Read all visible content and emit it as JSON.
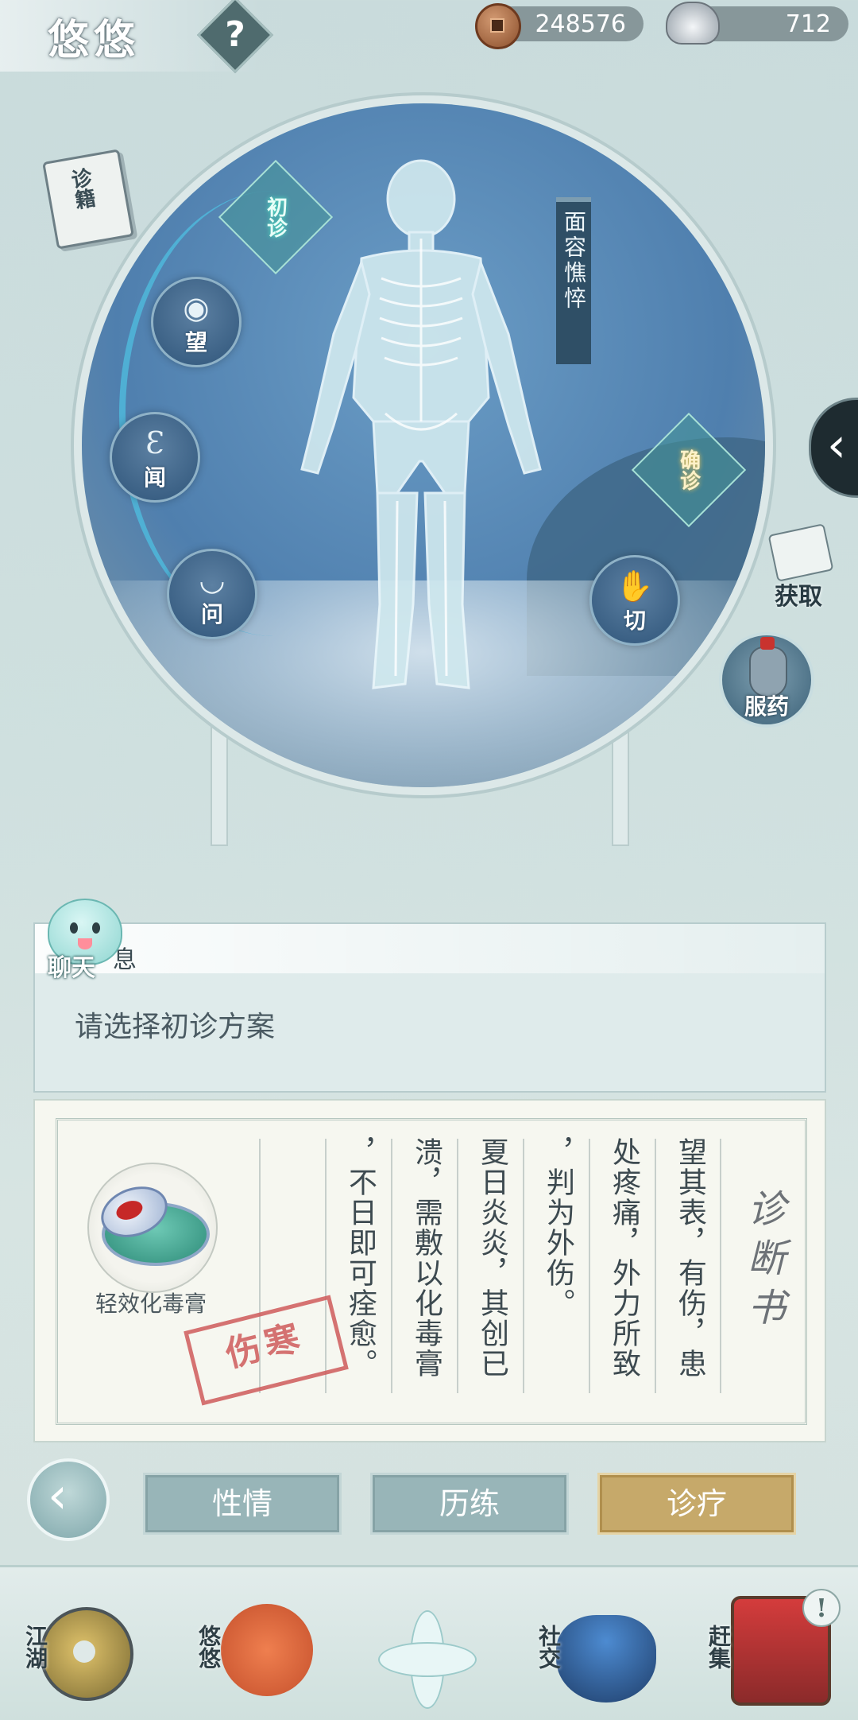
{
  "header": {
    "title": "悠悠",
    "help_label": "?",
    "coins": "248576",
    "silver": "712"
  },
  "stage": {
    "initial_diag": "初诊",
    "confirm_diag": "确诊",
    "methods": [
      "望",
      "闻",
      "问",
      "切"
    ],
    "symptom": "面容憔悴",
    "book_label": "诊籍",
    "obtain_label": "获取",
    "medicine_label": "服药"
  },
  "message": {
    "chat_label": "聊天",
    "header_text": "息",
    "text": "请选择初诊方案"
  },
  "diagnosis": {
    "title": "诊断书",
    "columns": [
      "望其表，有伤，患",
      "处疼痛，外力所致",
      "，判为外伤。",
      "夏日炎炎，其创已",
      "溃，需敷以化毒膏",
      "，不日即可痊愈。"
    ],
    "remedy": "轻效化毒膏",
    "stamp": "伤寒"
  },
  "tabs": [
    {
      "label": "性情",
      "active": false
    },
    {
      "label": "历练",
      "active": false
    },
    {
      "label": "诊疗",
      "active": true
    }
  ],
  "nav": {
    "jianghu": "江湖",
    "youyou": "悠悠",
    "shejiao": "社交",
    "ganji": "赶集",
    "alert": "!"
  },
  "colors": {
    "accent": "#4fb5d9",
    "active_tab": "#c6a96a",
    "stamp": "#cf5b5b"
  }
}
